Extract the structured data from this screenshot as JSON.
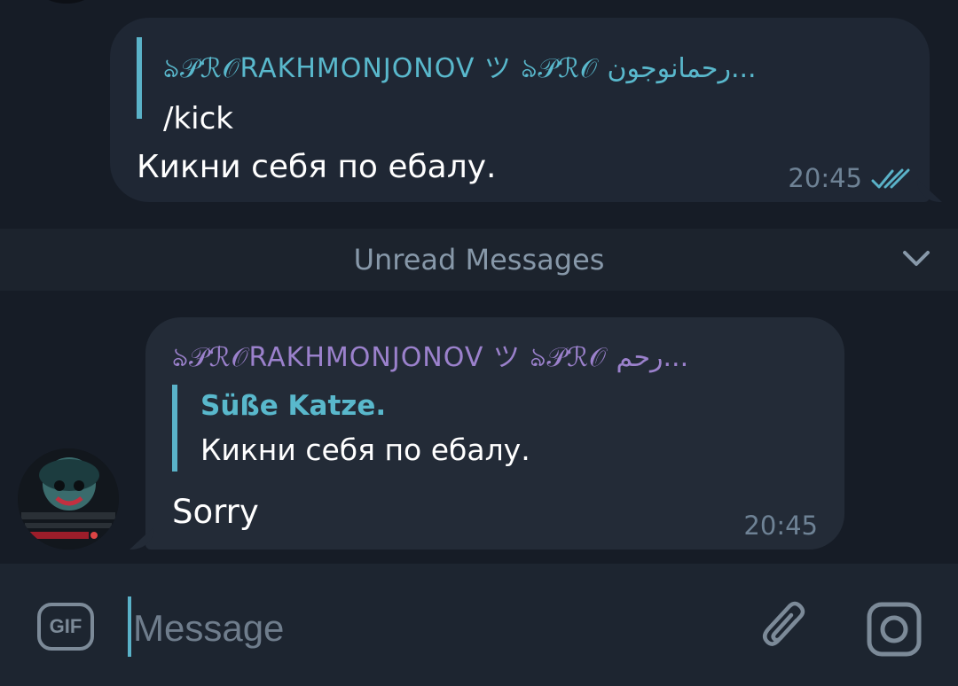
{
  "colors": {
    "background": "#161c26",
    "outgoing_bubble": "#1f2734",
    "incoming_bubble": "#232b37",
    "accent": "#5ab2c8",
    "sender_name": "#9b81cc",
    "time": "#6e8295"
  },
  "messages": {
    "outgoing": {
      "reply_to_name": "ঌ𝒫ℛ𝒪RAKHMONJONOV ツ ঌ𝒫ℛ𝒪 رحمانوجون...",
      "reply_to_text": "/kick",
      "text": "Кикни себя по ебалу.",
      "time": "20:45",
      "status_icon": "double-check-icon"
    },
    "incoming": {
      "sender": "ঌ𝒫ℛ𝒪RAKHMONJONOV ツ ঌ𝒫ℛ𝒪 رحم...",
      "reply_to_name": "Süße Katze.",
      "reply_to_text": "Кикни себя по ебалу.",
      "text": "Sorry",
      "time": "20:45"
    }
  },
  "divider": {
    "label": "Unread Messages",
    "icon": "chevron-down-icon"
  },
  "composer": {
    "gif_label": "GIF",
    "placeholder": "Message",
    "attach_icon": "paperclip-icon",
    "camera_icon": "camera-icon"
  }
}
